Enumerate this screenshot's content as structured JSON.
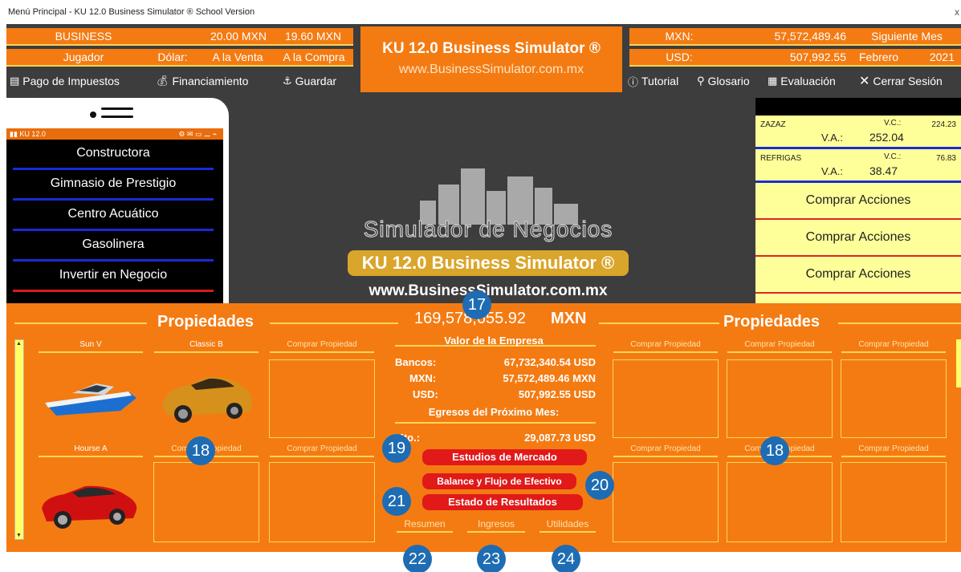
{
  "window": {
    "title": "Menú Principal - KU 12.0 Business Simulator ® School Version",
    "close": "x"
  },
  "header": {
    "business_label": "BUSINESS",
    "jugador_label": "Jugador",
    "sell_rate": "20.00 MXN",
    "buy_rate": "19.60 MXN",
    "dolar_label": "Dólar:",
    "venta_label": "A la Venta",
    "compra_label": "A la Compra",
    "mxn_label": "MXN:",
    "usd_label": "USD:",
    "mxn_value": "57,572,489.46",
    "usd_value": "507,992.55",
    "next_month": "Siguiente Mes",
    "month": "Febrero",
    "year": "2021"
  },
  "brand": {
    "title": "KU 12.0 Business Simulator ®",
    "url": "www.BusinessSimulator.com.mx"
  },
  "toolbar": {
    "taxes": "Pago de Impuestos",
    "financing": "Financiamiento",
    "save": "Guardar",
    "tutorial": "Tutorial",
    "glossary": "Glosario",
    "evaluation": "Evaluación",
    "logout": "Cerrar Sesión"
  },
  "phone": {
    "status_left": "KU 12.0",
    "menu": [
      "Constructora",
      "Gimnasio de Prestigio",
      "Centro Acuático",
      "Gasolinera",
      "Invertir en Negocio"
    ]
  },
  "logo": {
    "simulator": "Simulador de Negocios",
    "ku": "KU 12.0 Business Simulator ®",
    "web": "www.BusinessSimulator.com.mx"
  },
  "stocks": [
    {
      "name": "ZAZAZ",
      "vc_label": "V.C.:",
      "vc": "224.23",
      "va_label": "V.A.:",
      "va": "252.04"
    },
    {
      "name": "REFRIGAS",
      "vc_label": "V.C.:",
      "vc": "76.83",
      "va_label": "V.A.:",
      "va": "38.47"
    }
  ],
  "buy_stock_label": "Comprar Acciones",
  "properties": {
    "title": "Propiedades",
    "left": [
      {
        "label": "Sun V"
      },
      {
        "label": "Classic B"
      },
      {
        "label": "Comprar Propiedad"
      },
      {
        "label": "Hourse A"
      },
      {
        "label": "Comprar Propiedad"
      },
      {
        "label": "Comprar Propiedad"
      }
    ],
    "right": [
      {
        "label": "Comprar Propiedad"
      },
      {
        "label": "Comprar Propiedad"
      },
      {
        "label": "Comprar Propiedad"
      },
      {
        "label": "Comprar Propiedad"
      },
      {
        "label": "Comprar Propiedad"
      },
      {
        "label": "Comprar Propiedad"
      }
    ]
  },
  "company": {
    "value": "169,578,655.92",
    "currency": "MXN",
    "value_label": "Valor de la Empresa",
    "bancos_label": "Bancos:",
    "bancos_value": "67,732,340.54",
    "bancos_cur": "USD",
    "mxn_label": "MXN:",
    "mxn_value": "57,572,489.46",
    "mxn_cur": "MXN",
    "usd_label": "USD:",
    "usd_value": "507,992.55",
    "usd_cur": "USD",
    "expenses_label": "Egresos del Próximo Mes:",
    "mto_label": "Mto.:",
    "mto_value": "29,087.73",
    "mto_cur": "USD"
  },
  "actions": {
    "market": "Estudios de Mercado",
    "balance": "Balance y Flujo de Efectivo",
    "results": "Estado de Resultados"
  },
  "tabs": {
    "summary": "Resumen",
    "income": "Ingresos",
    "profits": "Utilidades"
  },
  "badges": [
    "17",
    "18",
    "18",
    "19",
    "20",
    "21",
    "22",
    "23",
    "24"
  ],
  "colors": {
    "orange": "#f47b12",
    "dark": "#3d3d3d",
    "yellow": "#ffff99",
    "red": "#e11919",
    "badge": "#1e6cb3"
  }
}
